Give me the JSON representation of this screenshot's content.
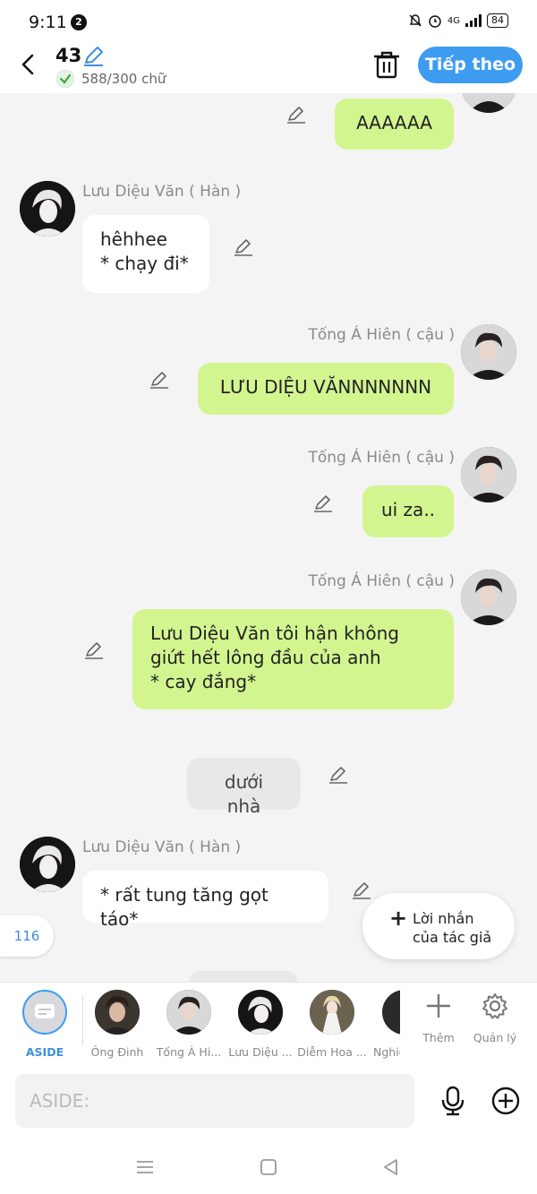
{
  "status_bar": {
    "time": "9:11",
    "notification_count": "2",
    "network": "4G",
    "battery": "84"
  },
  "header": {
    "chapter_title": "43",
    "word_count": "588/300 chữ",
    "continue_label": "Tiếp theo"
  },
  "messages": [
    {
      "text": "AAAAAA"
    },
    {
      "speaker": "Lưu Diệu Văn ( Hàn )",
      "text": "hêhhee\n* chạy đi*"
    },
    {
      "speaker": "Tống Á Hiên ( cậu )",
      "text": "LƯU DIỆU VĂNNNNNNN"
    },
    {
      "speaker": "Tống Á Hiên ( cậu )",
      "text": "ui za.."
    },
    {
      "speaker": "Tống Á Hiên ( cậu )",
      "text": "Lưu Diệu Văn tôi hận không\ngiứt hết lông đầu của anh\n* cay đắng*"
    },
    {
      "text": "dưới nhà"
    },
    {
      "speaker": "Lưu Diệu Văn ( Hàn )",
      "text": "* rất tung tăng gọt táo*"
    }
  ],
  "floating": {
    "word_pill": "116",
    "author_note_line1": "Lời nhắn",
    "author_note_line2": "của tác giả"
  },
  "characters": [
    {
      "label": "ASIDE"
    },
    {
      "label": "Ông Đinh"
    },
    {
      "label": "Tống Á Hi..."
    },
    {
      "label": "Lưu Diệu ..."
    },
    {
      "label": "Diễm Hoa ..."
    },
    {
      "label": "Nghiê"
    }
  ],
  "tools": {
    "add_label": "Thêm",
    "manage_label": "Quản lý"
  },
  "input": {
    "placeholder": "ASIDE:"
  },
  "colors": {
    "accent": "#3d9cf0",
    "bubble_green": "#d3f590",
    "bubble_white": "#ffffff",
    "narrator": "#e8e8e8"
  }
}
